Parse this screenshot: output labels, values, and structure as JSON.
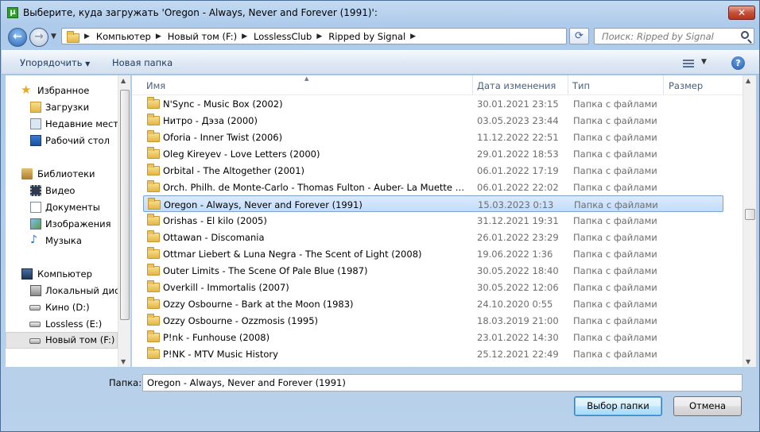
{
  "window": {
    "title": "Выберите, куда загружать 'Oregon - Always, Never and Forever (1991)':",
    "app_icon_letter": "µ"
  },
  "address": {
    "crumbs": [
      "Компьютер",
      "Новый том (F:)",
      "LosslessClub",
      "Ripped by Signal"
    ],
    "search_placeholder": "Поиск: Ripped by Signal"
  },
  "toolbar": {
    "organize_label": "Упорядочить",
    "new_folder_label": "Новая папка",
    "help_label": "?"
  },
  "nav": {
    "items": [
      {
        "label": "Избранное",
        "icon": "star-icon",
        "level": 0
      },
      {
        "label": "Загрузки",
        "icon": "downloads-folder-icon",
        "level": 1
      },
      {
        "label": "Недавние места",
        "icon": "recent-places-icon",
        "level": 1
      },
      {
        "label": "Рабочий стол",
        "icon": "desktop-icon",
        "level": 1
      },
      {
        "label": "Библиотеки",
        "icon": "libraries-icon",
        "level": 0
      },
      {
        "label": "Видео",
        "icon": "video-icon",
        "level": 1
      },
      {
        "label": "Документы",
        "icon": "documents-icon",
        "level": 1
      },
      {
        "label": "Изображения",
        "icon": "pictures-icon",
        "level": 1
      },
      {
        "label": "Музыка",
        "icon": "music-icon",
        "level": 1
      },
      {
        "label": "Компьютер",
        "icon": "computer-icon",
        "level": 0
      },
      {
        "label": "Локальный диск",
        "icon": "local-disk-icon",
        "level": 1
      },
      {
        "label": "Кино (D:)",
        "icon": "drive-icon",
        "level": 1
      },
      {
        "label": "Lossless (E:)",
        "icon": "drive-icon",
        "level": 1
      },
      {
        "label": "Новый том (F:)",
        "icon": "drive-icon",
        "level": 1,
        "selected": true
      }
    ]
  },
  "columns": {
    "name": "Имя",
    "date": "Дата изменения",
    "type": "Тип",
    "size": "Размер"
  },
  "files": [
    {
      "name": "N'Sync - Music Box (2002)",
      "date": "30.01.2021 23:15",
      "type": "Папка с файлами"
    },
    {
      "name": "Нитро - Дэза (2000)",
      "date": "03.05.2023 23:44",
      "type": "Папка с файлами"
    },
    {
      "name": "Oforia - Inner Twist (2006)",
      "date": "11.12.2022 22:51",
      "type": "Папка с файлами"
    },
    {
      "name": "Oleg Kireyev - Love Letters (2000)",
      "date": "29.01.2022 18:53",
      "type": "Папка с файлами"
    },
    {
      "name": "Orbital - The Altogether (2001)",
      "date": "06.01.2022 17:19",
      "type": "Папка с файлами"
    },
    {
      "name": "Orch. Philh. de Monte-Carlo - Thomas Fulton - Auber- La Muette de P...",
      "date": "06.01.2022 22:02",
      "type": "Папка с файлами"
    },
    {
      "name": "Oregon - Always, Never and Forever (1991)",
      "date": "15.03.2023 0:13",
      "type": "Папка с файлами",
      "selected": true
    },
    {
      "name": "Orishas - El kilo (2005)",
      "date": "31.12.2021 19:31",
      "type": "Папка с файлами"
    },
    {
      "name": "Ottawan - Discomania",
      "date": "26.01.2022 23:29",
      "type": "Папка с файлами"
    },
    {
      "name": "Ottmar Liebert & Luna Negra - The Scent of Light (2008)",
      "date": "19.06.2022 1:36",
      "type": "Папка с файлами"
    },
    {
      "name": "Outer Limits  - The Scene Of Pale Blue (1987)",
      "date": "30.05.2022 18:40",
      "type": "Папка с файлами"
    },
    {
      "name": "Overkill - Immortalis (2007)",
      "date": "30.05.2022 12:06",
      "type": "Папка с файлами"
    },
    {
      "name": "Ozzy Osbourne - Bark at the Moon (1983)",
      "date": "24.10.2020 0:55",
      "type": "Папка с файлами"
    },
    {
      "name": "Ozzy Osbourne - Ozzmosis (1995)",
      "date": "18.03.2019 21:00",
      "type": "Папка с файлами"
    },
    {
      "name": "P!nk - Funhouse (2008)",
      "date": "23.01.2022 14:30",
      "type": "Папка с файлами"
    },
    {
      "name": "P!NK - MTV Music History",
      "date": "25.12.2021 22:49",
      "type": "Папка с файлами"
    }
  ],
  "bottom": {
    "folder_label": "Папка:",
    "folder_value": "Oregon - Always, Never and Forever (1991)",
    "ok_label": "Выбор папки",
    "cancel_label": "Отмена"
  }
}
